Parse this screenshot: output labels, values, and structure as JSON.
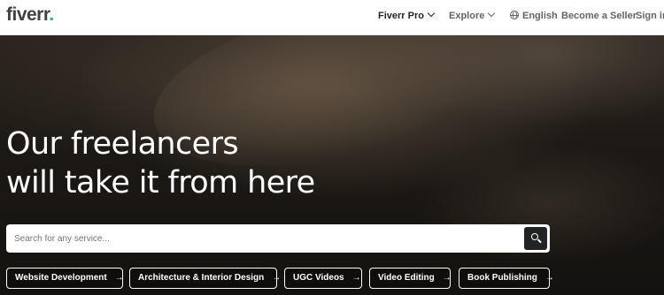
{
  "header": {
    "logo_text": "fiverr",
    "logo_dot": ".",
    "nav": {
      "fiverr_pro": "Fiverr Pro",
      "explore": "Explore",
      "language": "English",
      "become_seller": "Become a Seller",
      "sign_in": "Sign in"
    }
  },
  "hero": {
    "headline_line1": "Our freelancers",
    "headline_line2": "will take it from here",
    "search": {
      "placeholder": "Search for any service...",
      "value": ""
    },
    "categories": [
      {
        "label": "Website Development",
        "icon": "arrow-right-icon"
      },
      {
        "label": "Architecture & Interior Design",
        "icon": "arrow-right-icon"
      },
      {
        "label": "UGC Videos",
        "icon": "arrow-right-icon"
      },
      {
        "label": "Video Editing",
        "icon": "arrow-right-icon"
      },
      {
        "label": "Book Publishing",
        "icon": "arrow-right-icon"
      }
    ],
    "arrow_glyph": "→"
  },
  "colors": {
    "brand_green": "#1dbf73",
    "text_dark": "#404145",
    "search_button": "#222325"
  }
}
